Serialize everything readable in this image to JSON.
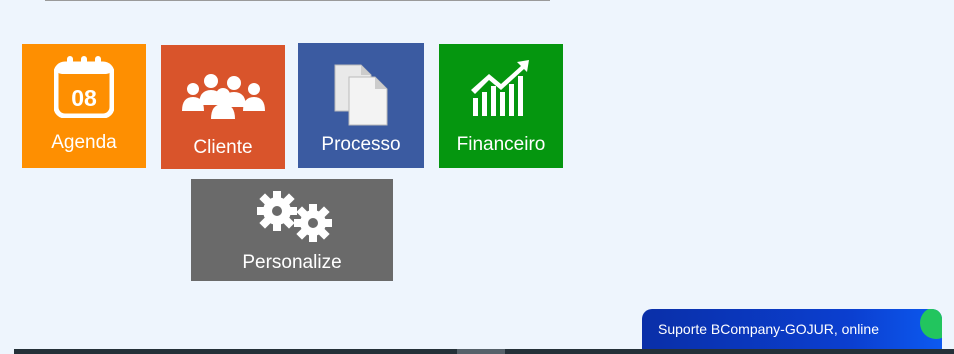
{
  "tiles": {
    "agenda": {
      "label": "Agenda",
      "day": "08",
      "color": "#fe8f01"
    },
    "cliente": {
      "label": "Cliente",
      "color": "#d9542b"
    },
    "processo": {
      "label": "Processo",
      "color": "#3b5ba1"
    },
    "financeiro": {
      "label": "Financeiro",
      "color": "#05960f"
    },
    "personalize": {
      "label": "Personalize",
      "color": "#6a6a6a"
    }
  },
  "icons": {
    "agenda": "calendar-icon",
    "cliente": "users-group-icon",
    "processo": "documents-icon",
    "financeiro": "chart-growth-icon",
    "personalize": "gears-icon"
  },
  "chat": {
    "text": "Suporte BCompany-GOJUR, online",
    "status_color": "#22c55e"
  }
}
